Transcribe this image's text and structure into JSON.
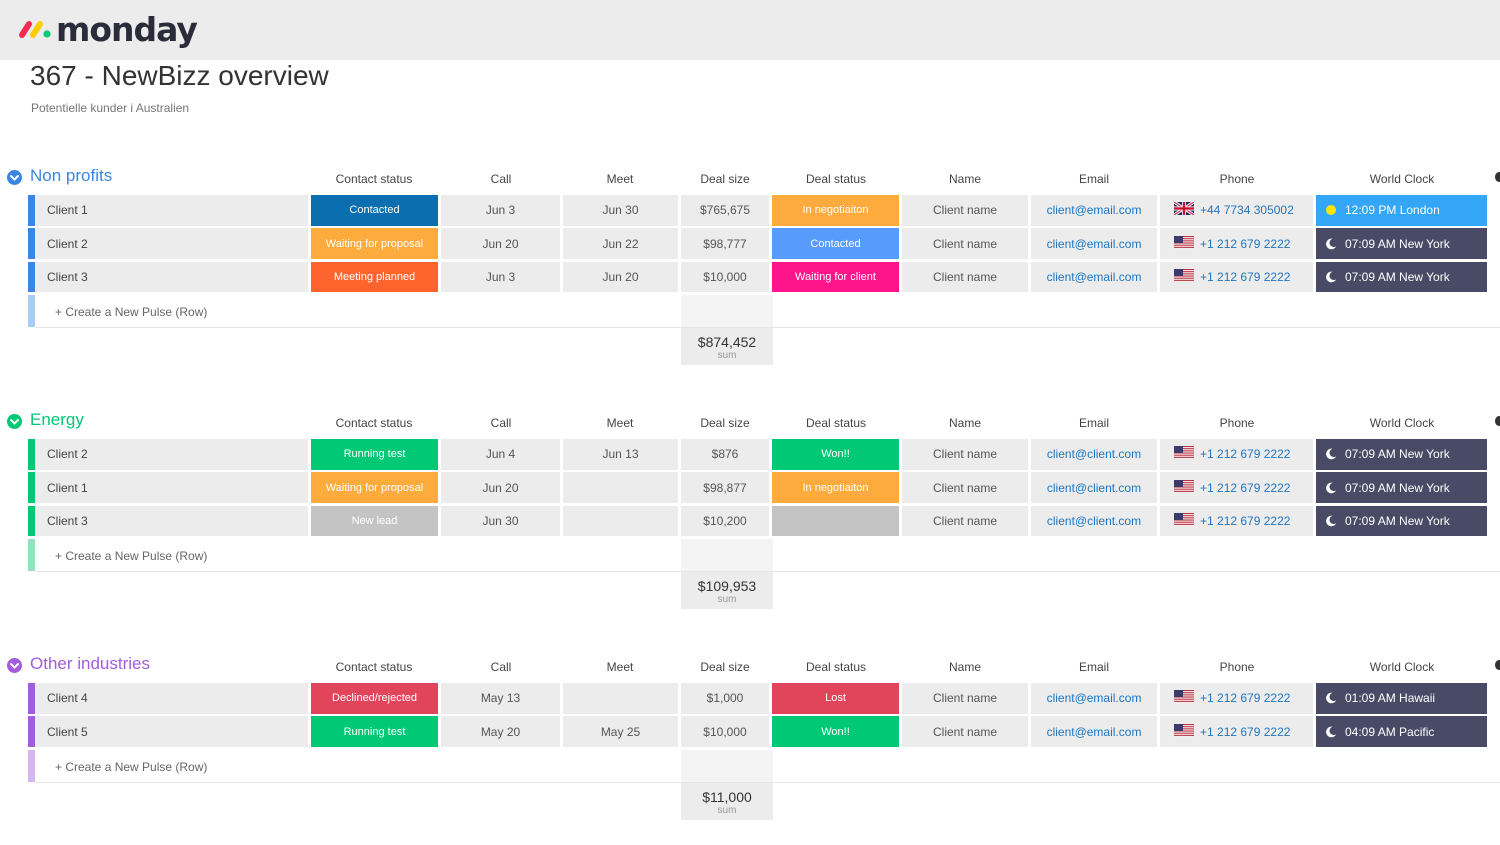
{
  "app": {
    "logo_text": "monday"
  },
  "page": {
    "title": "367 - NewBizz overview",
    "subtitle": "Potentielle kunder i Australien"
  },
  "columns": [
    "Contact status",
    "Call",
    "Meet",
    "Deal size",
    "Deal status",
    "Name",
    "Email",
    "Phone",
    "World Clock"
  ],
  "colors": {
    "navy": "#0b6faf",
    "orange": "#fdab3d",
    "coral": "#ff642e",
    "blue": "#579bfc",
    "pink": "#ff158a",
    "green": "#00c875",
    "grey": "#c4c4c4",
    "red": "#e2445c",
    "dark": "#494b66",
    "sky": "#33a6f8"
  },
  "groups": [
    {
      "title": "Non profits",
      "color": "#3b86e0",
      "light": "#a8cdf7",
      "rows": [
        {
          "name": "Client 1",
          "contact_status": "Contacted",
          "cs_color": "navy",
          "call": "Jun 3",
          "meet": "Jun 30",
          "deal_size": "$765,675",
          "deal_status": "In negotiaiton",
          "ds_color": "orange",
          "client": "Client name",
          "email": "client@email.com",
          "flag": "uk",
          "phone": "+44 7734 305002",
          "clock": "12:09 PM London",
          "clock_type": "sun",
          "clock_color": "sky"
        },
        {
          "name": "Client 2",
          "contact_status": "Waiting for proposal",
          "cs_color": "orange",
          "call": "Jun 20",
          "meet": "Jun 22",
          "deal_size": "$98,777",
          "deal_status": "Contacted",
          "ds_color": "blue",
          "client": "Client name",
          "email": "client@email.com",
          "flag": "us",
          "phone": "+1 212 679 2222",
          "clock": "07:09 AM New York",
          "clock_type": "moon",
          "clock_color": "dark"
        },
        {
          "name": "Client 3",
          "contact_status": "Meeting planned",
          "cs_color": "coral",
          "call": "Jun 3",
          "meet": "Jun 20",
          "deal_size": "$10,000",
          "deal_status": "Waiting for client",
          "ds_color": "pink",
          "client": "Client name",
          "email": "client@email.com",
          "flag": "us",
          "phone": "+1 212 679 2222",
          "clock": "07:09 AM New York",
          "clock_type": "moon",
          "clock_color": "dark"
        }
      ],
      "create_label": "+ Create a New Pulse (Row)",
      "sum": "$874,452",
      "sum_label": "sum"
    },
    {
      "title": "Energy",
      "color": "#00c875",
      "light": "#8fe3bd",
      "rows": [
        {
          "name": "Client 2",
          "contact_status": "Running test",
          "cs_color": "green",
          "call": "Jun 4",
          "meet": "Jun 13",
          "deal_size": "$876",
          "deal_status": "Won!!",
          "ds_color": "green",
          "client": "Client name",
          "email": "client@client.com",
          "flag": "us",
          "phone": "+1 212 679 2222",
          "clock": "07:09 AM New York",
          "clock_type": "moon",
          "clock_color": "dark"
        },
        {
          "name": "Client 1",
          "contact_status": "Waiting for proposal",
          "cs_color": "orange",
          "call": "Jun 20",
          "meet": "",
          "deal_size": "$98,877",
          "deal_status": "In negotiaiton",
          "ds_color": "orange",
          "client": "Client name",
          "email": "client@client.com",
          "flag": "us",
          "phone": "+1 212 679 2222",
          "clock": "07:09 AM New York",
          "clock_type": "moon",
          "clock_color": "dark"
        },
        {
          "name": "Client 3",
          "contact_status": "New lead",
          "cs_color": "grey",
          "call": "Jun 30",
          "meet": "",
          "deal_size": "$10,200",
          "deal_status": "",
          "ds_color": "grey",
          "client": "Client name",
          "email": "client@client.com",
          "flag": "us",
          "phone": "+1 212 679 2222",
          "clock": "07:09 AM New York",
          "clock_type": "moon",
          "clock_color": "dark"
        }
      ],
      "create_label": "+ Create a New Pulse (Row)",
      "sum": "$109,953",
      "sum_label": "sum"
    },
    {
      "title": "Other industries",
      "color": "#a25ddc",
      "light": "#d5b6ef",
      "rows": [
        {
          "name": "Client 4",
          "contact_status": "Declined/rejected",
          "cs_color": "red",
          "call": "May 13",
          "meet": "",
          "deal_size": "$1,000",
          "deal_status": "Lost",
          "ds_color": "red",
          "client": "Client name",
          "email": "client@email.com",
          "flag": "us",
          "phone": "+1 212 679 2222",
          "clock": "01:09 AM Hawaii",
          "clock_type": "moon",
          "clock_color": "dark"
        },
        {
          "name": "Client 5",
          "contact_status": "Running test",
          "cs_color": "green",
          "call": "May 20",
          "meet": "May 25",
          "deal_size": "$10,000",
          "deal_status": "Won!!",
          "ds_color": "green",
          "client": "Client name",
          "email": "client@email.com",
          "flag": "us",
          "phone": "+1 212 679 2222",
          "clock": "04:09 AM Pacific",
          "clock_type": "moon",
          "clock_color": "dark"
        }
      ],
      "create_label": "+ Create a New Pulse (Row)",
      "sum": "$11,000",
      "sum_label": "sum"
    }
  ]
}
